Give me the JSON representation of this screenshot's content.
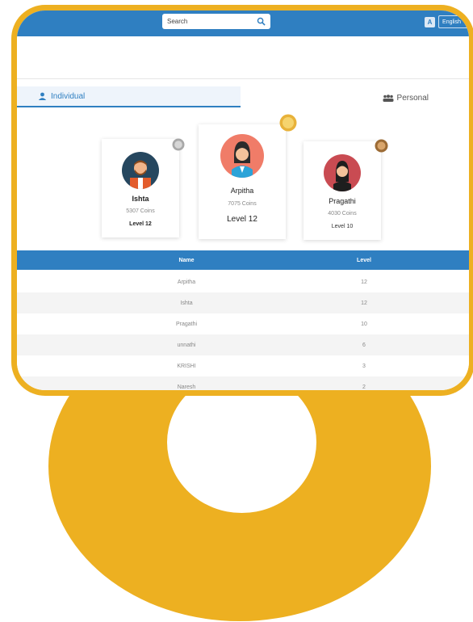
{
  "header": {
    "search_placeholder": "Search",
    "language_label": "English"
  },
  "tabs": {
    "individual": "Individual",
    "personal": "Personal"
  },
  "podium": [
    {
      "rank": 2,
      "name": "Ishta",
      "coins": "5307 Coins",
      "level": "Level 12"
    },
    {
      "rank": 1,
      "name": "Arpitha",
      "coins": "7075 Coins",
      "level": "Level 12"
    },
    {
      "rank": 3,
      "name": "Pragathi",
      "coins": "4030 Coins",
      "level": "Level 10"
    }
  ],
  "table": {
    "headers": {
      "name": "Name",
      "level": "Level"
    },
    "rows": [
      {
        "name": "Arpitha",
        "level": "12"
      },
      {
        "name": "Ishta",
        "level": "12"
      },
      {
        "name": "Pragathi",
        "level": "10"
      },
      {
        "name": "unnathi",
        "level": "6"
      },
      {
        "name": "KRISHI",
        "level": "3"
      },
      {
        "name": "Naresh",
        "level": "2"
      }
    ]
  },
  "colors": {
    "accent": "#EDB021",
    "primary": "#2F7FC1",
    "gold": "#E8B23A",
    "silver": "#A8A8A8",
    "bronze": "#9C6B35"
  }
}
